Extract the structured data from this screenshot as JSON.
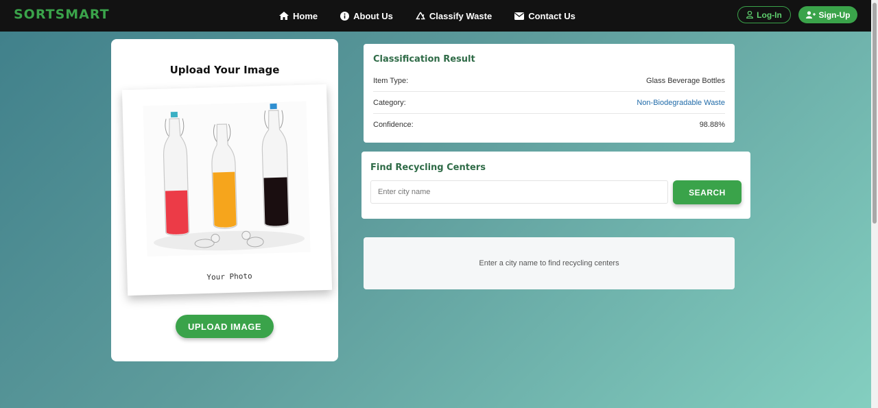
{
  "nav": {
    "brand": "SORTSMART",
    "links": [
      {
        "label": "Home",
        "icon": "home-icon"
      },
      {
        "label": "About Us",
        "icon": "info-icon"
      },
      {
        "label": "Classify Waste",
        "icon": "recycle-icon"
      },
      {
        "label": "Contact Us",
        "icon": "envelope-icon"
      }
    ],
    "login_label": "Log-In",
    "signup_label": "Sign-Up"
  },
  "upload": {
    "title": "Upload Your Image",
    "photo_caption": "Your Photo",
    "button_label": "UPLOAD IMAGE"
  },
  "result": {
    "title": "Classification Result",
    "rows": [
      {
        "label": "Item Type:",
        "value": "Glass Beverage Bottles"
      },
      {
        "label": "Category:",
        "value": "Non-Biodegradable Waste"
      },
      {
        "label": "Confidence:",
        "value": "98.88%"
      }
    ]
  },
  "recycling": {
    "title": "Find Recycling Centers",
    "input_placeholder": "Enter city name",
    "input_value": "",
    "button_label": "SEARCH",
    "info_text": "Enter a city name to find recycling centers"
  },
  "colors": {
    "accent": "#3aa34a",
    "heading": "#2f6b47",
    "link": "#1f6aa8",
    "nav_bg": "#121212"
  }
}
